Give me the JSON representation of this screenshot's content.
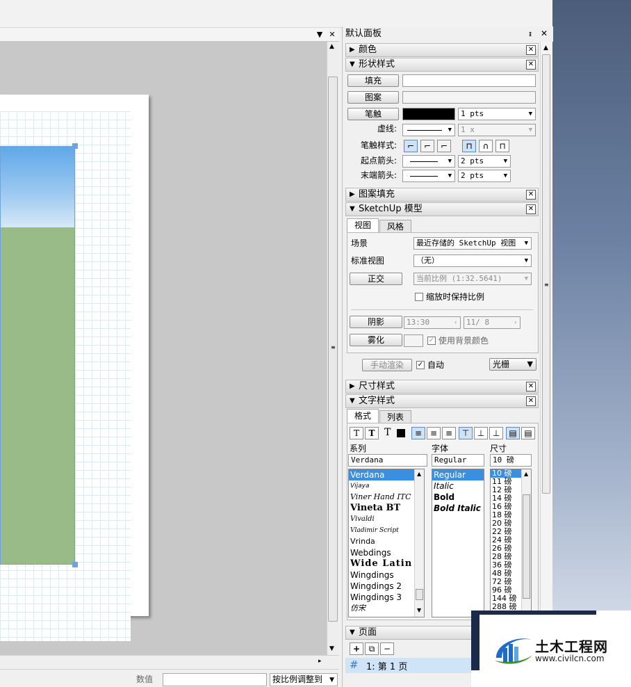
{
  "panel": {
    "title": "默认面板",
    "pin": "ᵻ",
    "close": "✕"
  },
  "sections": {
    "color": "颜色",
    "shape": "形状样式",
    "pattern": "图案填充",
    "sketchup": "SketchUp 模型",
    "dimension": "尺寸样式",
    "text": "文字样式",
    "pages": "页面"
  },
  "shape": {
    "fill": "填充",
    "pattern": "图案",
    "stroke": "笔触",
    "stroke_width": "1 pts",
    "dash_label": "虚线:",
    "dash_scale": "1 x",
    "stroke_style_label": "笔触样式:",
    "start_arrow_label": "起点箭头:",
    "start_arrow_size": "2 pts",
    "end_arrow_label": "末端箭头:",
    "end_arrow_size": "2 pts"
  },
  "sketchup": {
    "tabs": [
      "视图",
      "风格"
    ],
    "scene_label": "场景",
    "scene_value": "最近存储的 SketchUp 视图",
    "std_view_label": "标准视图",
    "std_view_value": "（无）",
    "ortho": "正交",
    "scale_value": "当前比例 (1:32.5641)",
    "keep_scale": "缩放时保持比例",
    "shadow": "阴影",
    "time": "13:30",
    "date": "11/ 8",
    "fog": "雾化",
    "use_bg": "使用背景颜色",
    "manual_render": "手动渲染",
    "auto": "自动",
    "render_mode": "光栅"
  },
  "text": {
    "tabs": [
      "格式",
      "列表"
    ],
    "family_label": "系列",
    "font_label": "字体",
    "size_label": "尺寸",
    "family_value": "Verdana",
    "font_value": "Regular",
    "size_value": "10 磅",
    "families": [
      "Verdana",
      "Vijaya",
      "Viner Hand ITC",
      "Vineta BT",
      "Vivaldi",
      "Vladimir Script",
      "Vrinda",
      "Webdings",
      "Wide Latin",
      "Wingdings",
      "Wingdings 2",
      "Wingdings 3",
      "仿宋"
    ],
    "styles": [
      "Regular",
      "Italic",
      "Bold",
      "Bold Italic"
    ],
    "sizes": [
      "10 磅",
      "11 磅",
      "12 磅",
      "14 磅",
      "16 磅",
      "18 磅",
      "20 磅",
      "22 磅",
      "24 磅",
      "26 磅",
      "28 磅",
      "36 磅",
      "48 磅",
      "72 磅",
      "96 磅",
      "144 磅",
      "288 磅"
    ]
  },
  "pages": {
    "add": "+",
    "dup": "⧉",
    "remove": "−",
    "first": "1: 第 1 页",
    "hash": "#"
  },
  "status": {
    "value_label": "数值",
    "scale_to_fit": "按比例调整到"
  },
  "watermark": {
    "brand": "土木工程网",
    "url": "www.civilcn.com"
  },
  "colors": {
    "accent": "#3b8fe0",
    "sky": "#9fcaf0",
    "ground": "#98bb88"
  }
}
